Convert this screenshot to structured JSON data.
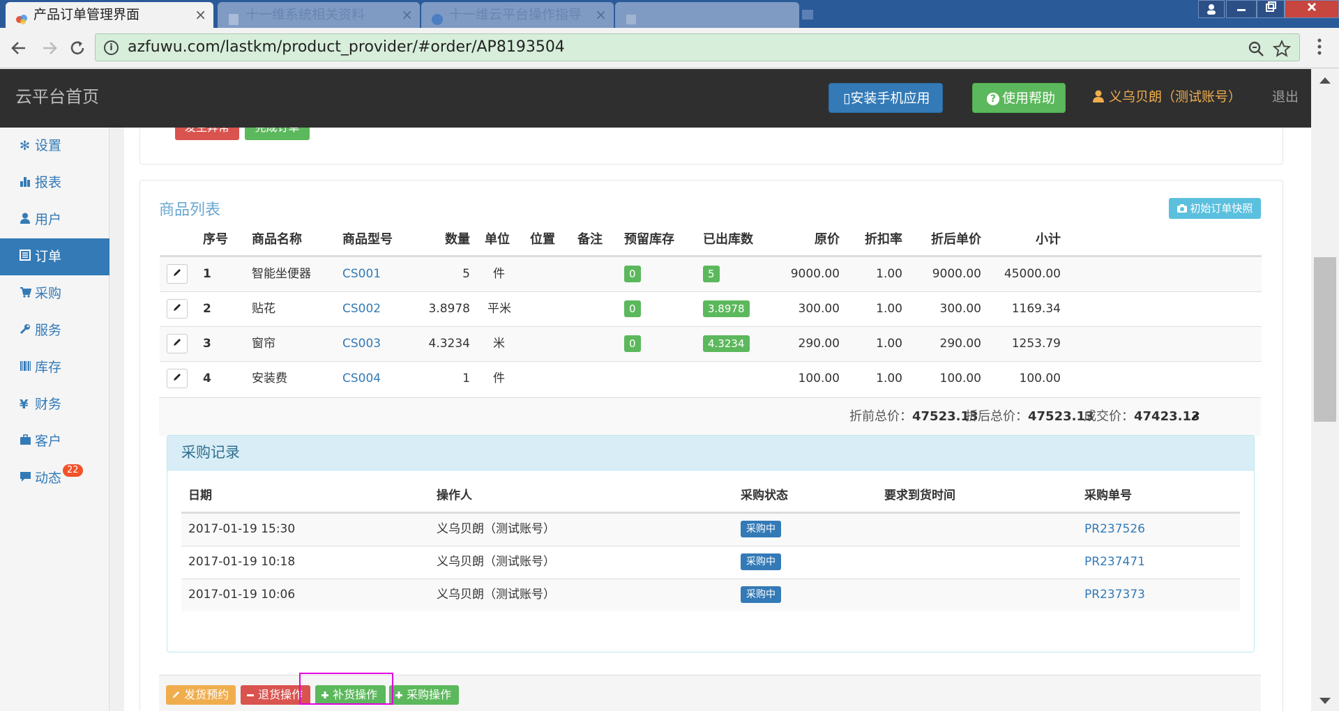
{
  "browser": {
    "tabs": [
      {
        "title": "产品订单管理界面",
        "active": true
      },
      {
        "title": "十一维系统相关资料",
        "active": false
      },
      {
        "title": "十一维云平台操作指导",
        "active": false
      },
      {
        "title": "",
        "active": false
      }
    ],
    "close_glyph": "×",
    "url": "azfuwu.com/lastkm/product_provider/#order/AP8193504",
    "address_bar_color": "#d7eeda"
  },
  "header": {
    "brand": "云平台首页",
    "install_app": "安装手机应用",
    "help": "使用帮助",
    "user": "义乌贝朗（测试账号）",
    "logout": "退出"
  },
  "sidebar": {
    "items": [
      {
        "label": "设置",
        "icon": "gear-icon"
      },
      {
        "label": "报表",
        "icon": "bar-chart-icon"
      },
      {
        "label": "用户",
        "icon": "user-icon"
      },
      {
        "label": "订单",
        "icon": "list-icon",
        "active": true
      },
      {
        "label": "采购",
        "icon": "cart-icon"
      },
      {
        "label": "服务",
        "icon": "wrench-icon"
      },
      {
        "label": "库存",
        "icon": "barcode-icon"
      },
      {
        "label": "财务",
        "icon": "yen-icon"
      },
      {
        "label": "客户",
        "icon": "briefcase-icon"
      },
      {
        "label": "动态",
        "icon": "comment-icon",
        "badge": "22"
      }
    ]
  },
  "order_actions": {
    "exception": "发生异常",
    "complete": "完成订单"
  },
  "goods": {
    "title": "商品列表",
    "snapshot_button": "初始订单快照",
    "columns": [
      "序号",
      "商品名称",
      "商品型号",
      "数量",
      "单位",
      "位置",
      "备注",
      "预留库存",
      "已出库数",
      "原价",
      "折扣率",
      "折后单价",
      "小计"
    ],
    "rows": [
      {
        "no": "1",
        "name": "智能坐便器",
        "model": "CS001",
        "qty": "5",
        "unit": "件",
        "reserved": "0",
        "shipped": "5",
        "price": "9000.00",
        "discount": "1.00",
        "unit_price": "9000.00",
        "subtotal": "45000.00"
      },
      {
        "no": "2",
        "name": "贴花",
        "model": "CS002",
        "qty": "3.8978",
        "unit": "平米",
        "reserved": "0",
        "shipped": "3.8978",
        "price": "300.00",
        "discount": "1.00",
        "unit_price": "300.00",
        "subtotal": "1169.34"
      },
      {
        "no": "3",
        "name": "窗帘",
        "model": "CS003",
        "qty": "4.3234",
        "unit": "米",
        "reserved": "0",
        "shipped": "4.3234",
        "price": "290.00",
        "discount": "1.00",
        "unit_price": "290.00",
        "subtotal": "1253.79"
      },
      {
        "no": "4",
        "name": "安装费",
        "model": "CS004",
        "qty": "1",
        "unit": "件",
        "reserved": "",
        "shipped": "",
        "price": "100.00",
        "discount": "1.00",
        "unit_price": "100.00",
        "subtotal": "100.00"
      }
    ],
    "totals": {
      "pre_label": "折前总价：",
      "pre_value": "47523.13",
      "post_label": "折后总价：",
      "post_value": "47523.13",
      "deal_label": "成交价：",
      "deal_value": "47423.13"
    }
  },
  "purchase": {
    "title": "采购记录",
    "columns": [
      "日期",
      "操作人",
      "采购状态",
      "要求到货时间",
      "采购单号"
    ],
    "rows": [
      {
        "date": "2017-01-19 15:30",
        "operator": "义乌贝朗（测试账号）",
        "status": "采购中",
        "due": "",
        "po": "PR237526"
      },
      {
        "date": "2017-01-19 10:18",
        "operator": "义乌贝朗（测试账号）",
        "status": "采购中",
        "due": "",
        "po": "PR237471"
      },
      {
        "date": "2017-01-19 10:06",
        "operator": "义乌贝朗（测试账号）",
        "status": "采购中",
        "due": "",
        "po": "PR237373"
      }
    ]
  },
  "bottom_actions": {
    "ship": "发货预约",
    "return": "退货操作",
    "restock": "补货操作",
    "purchase": "采购操作"
  },
  "colors": {
    "primary": "#337ab7",
    "success": "#5cb85c",
    "danger": "#d9534f",
    "warning": "#f0ad4e",
    "info": "#5bc0de",
    "highlight": "#e100e1"
  }
}
